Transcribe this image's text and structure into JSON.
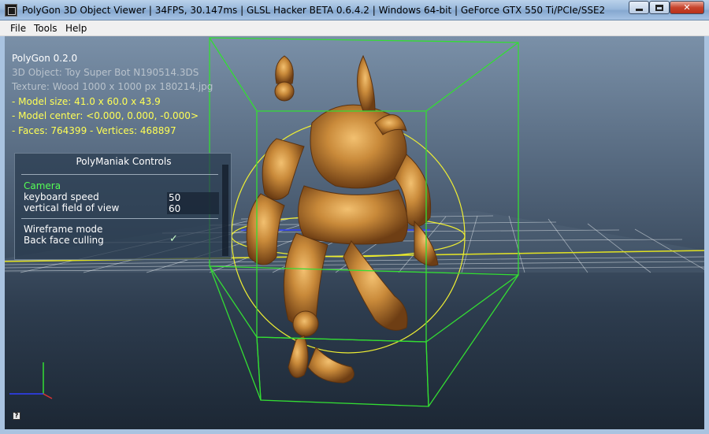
{
  "window": {
    "title": "PolyGon 3D Object Viewer | 34FPS, 30.147ms | GLSL Hacker BETA 0.6.4.2 | Windows 64-bit | GeForce GTX 550 Ti/PCIe/SSE2",
    "minimize_icon": "minimize-icon",
    "maximize_icon": "maximize-icon",
    "close_icon": "close-icon",
    "close_glyph": "✕"
  },
  "menu": {
    "items": [
      {
        "label": "File"
      },
      {
        "label": "Tools"
      },
      {
        "label": "Help"
      }
    ]
  },
  "overlay": {
    "app_name": "PolyGon 0.2.0",
    "object_line": "3D Object: Toy Super Bot N190514.3DS",
    "texture_line": "Texture: Wood 1000 x 1000 px 180214.jpg",
    "model_size": "- Model size:  41.0 x 60.0 x 43.9",
    "model_center": "- Model center:  <0.000, 0.000, -0.000>",
    "faces_vertices": "- Faces: 764399 - Vertices: 468897"
  },
  "panel": {
    "title": "PolyManiak Controls",
    "camera_section": "Camera",
    "keyboard_speed_label": "keyboard speed",
    "keyboard_speed_value": "50",
    "fov_label": "vertical field of view",
    "fov_value": "60",
    "wireframe_label": "Wireframe mode",
    "backface_label": "Back face culling",
    "backface_checked": true,
    "check_glyph": "✓"
  },
  "footer": {
    "help_glyph": "?"
  },
  "colors": {
    "bbox": "#33dd33",
    "bsphere": "#eeee33",
    "grid": "#ffffff",
    "model": "#c98a3a"
  }
}
